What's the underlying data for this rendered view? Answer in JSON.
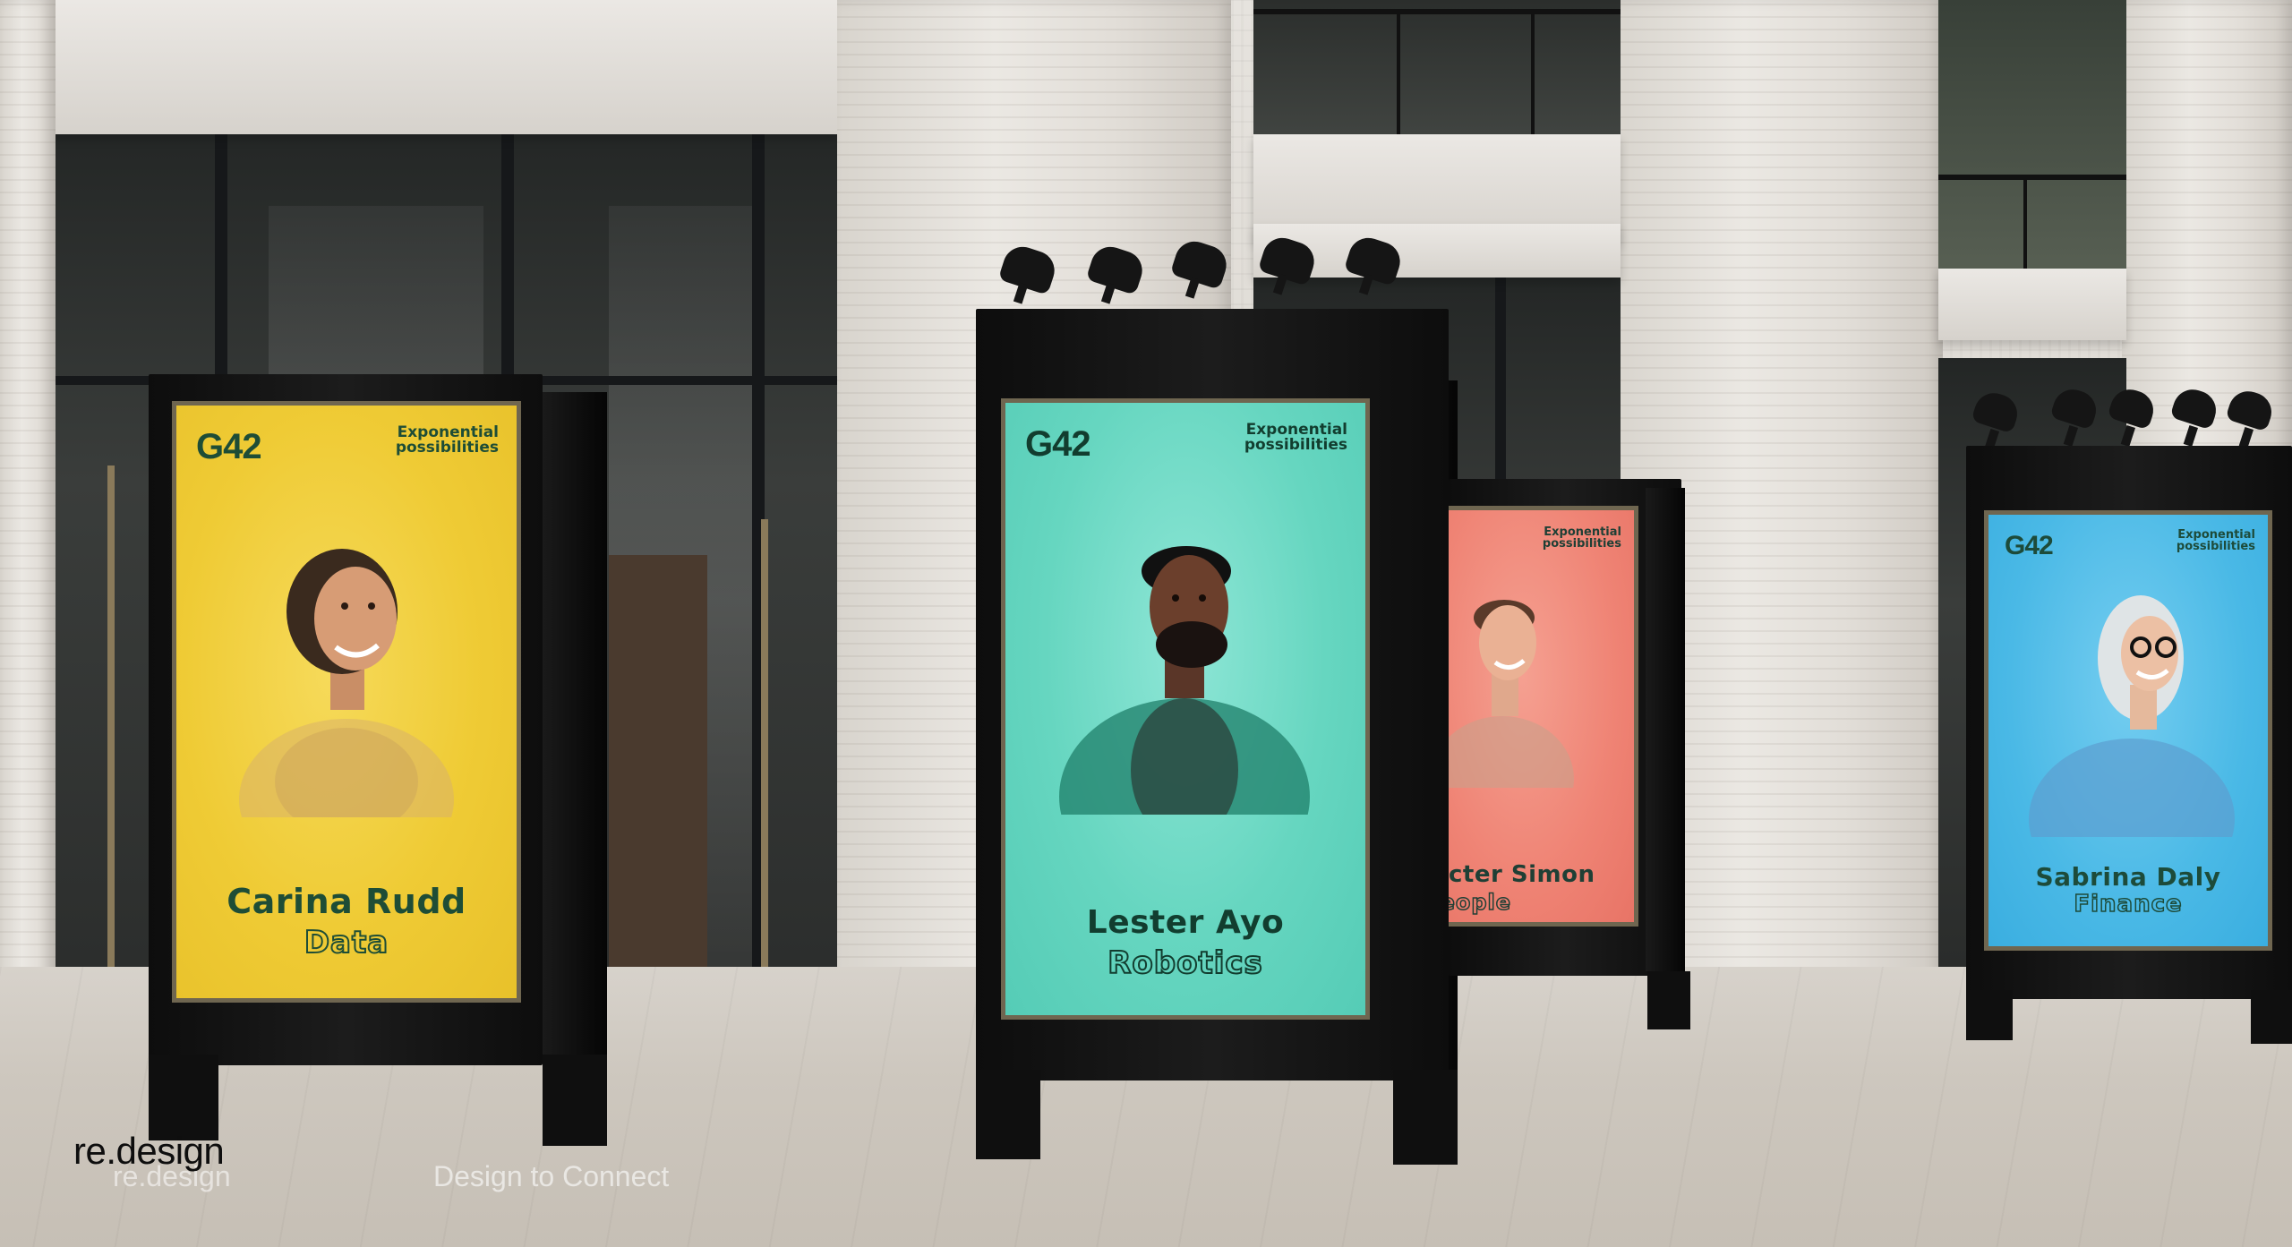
{
  "brand_tagline": "Exponential possibilities",
  "logo_text": "G42",
  "posters": [
    {
      "name": "Carina Rudd",
      "role": "Data",
      "bg": "#f2cf3a",
      "ink": "#1d4d36"
    },
    {
      "name": "Lester Ayo",
      "role": "Robotics",
      "bg": "#6fd8c2",
      "ink": "#123d2f"
    },
    {
      "name": "cter Simon",
      "role": "People",
      "bg": "#f0857a",
      "ink": "#1f3f35"
    },
    {
      "name": "Sabrina Daly",
      "role": "Finance",
      "bg": "#49b8e6",
      "ink": "#1d4b3a"
    }
  ],
  "overlay": {
    "brand": "re.design",
    "brand_ghost": "re.design",
    "tagline": "Design to Connect"
  }
}
